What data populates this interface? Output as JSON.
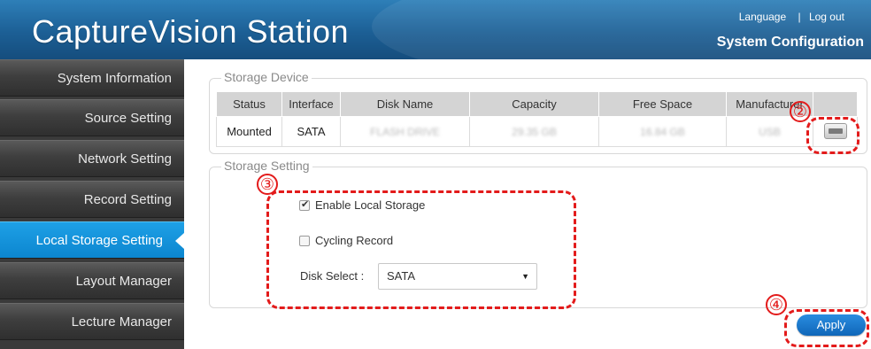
{
  "header": {
    "app_title": "CaptureVision Station",
    "language_link": "Language",
    "separator": "|",
    "logout_link": "Log out",
    "page_heading": "System Configuration"
  },
  "sidebar": {
    "items": [
      {
        "label": "System Information"
      },
      {
        "label": "Source Setting"
      },
      {
        "label": "Network Setting"
      },
      {
        "label": "Record Setting"
      },
      {
        "label": "Local Storage Setting",
        "active": true
      },
      {
        "label": "Layout Manager"
      },
      {
        "label": "Lecture Manager"
      }
    ]
  },
  "storage_device": {
    "legend": "Storage Device",
    "columns": [
      "Status",
      "Interface",
      "Disk Name",
      "Capacity",
      "Free Space",
      "Manufacturer"
    ],
    "row": {
      "status": "Mounted",
      "interface": "SATA",
      "disk_name": "FLASH DRIVE",
      "capacity": "29.35 GB",
      "free_space": "16.84 GB",
      "manufacturer": "USB"
    }
  },
  "storage_setting": {
    "legend": "Storage Setting",
    "enable_local_storage": {
      "label": "Enable Local Storage",
      "checked": true
    },
    "cycling_record": {
      "label": "Cycling Record",
      "checked": false
    },
    "disk_select": {
      "label": "Disk Select :",
      "value": "SATA"
    }
  },
  "annotations": {
    "marker_2": "②",
    "marker_3": "③",
    "marker_4": "④",
    "color": "#e31b1b"
  },
  "apply_label": "Apply",
  "colors": {
    "header_blue": "#1c5f95",
    "active_nav": "#0c86cf",
    "sidebar_dark": "#3a3a3a",
    "apply_blue": "#0f66b8"
  }
}
